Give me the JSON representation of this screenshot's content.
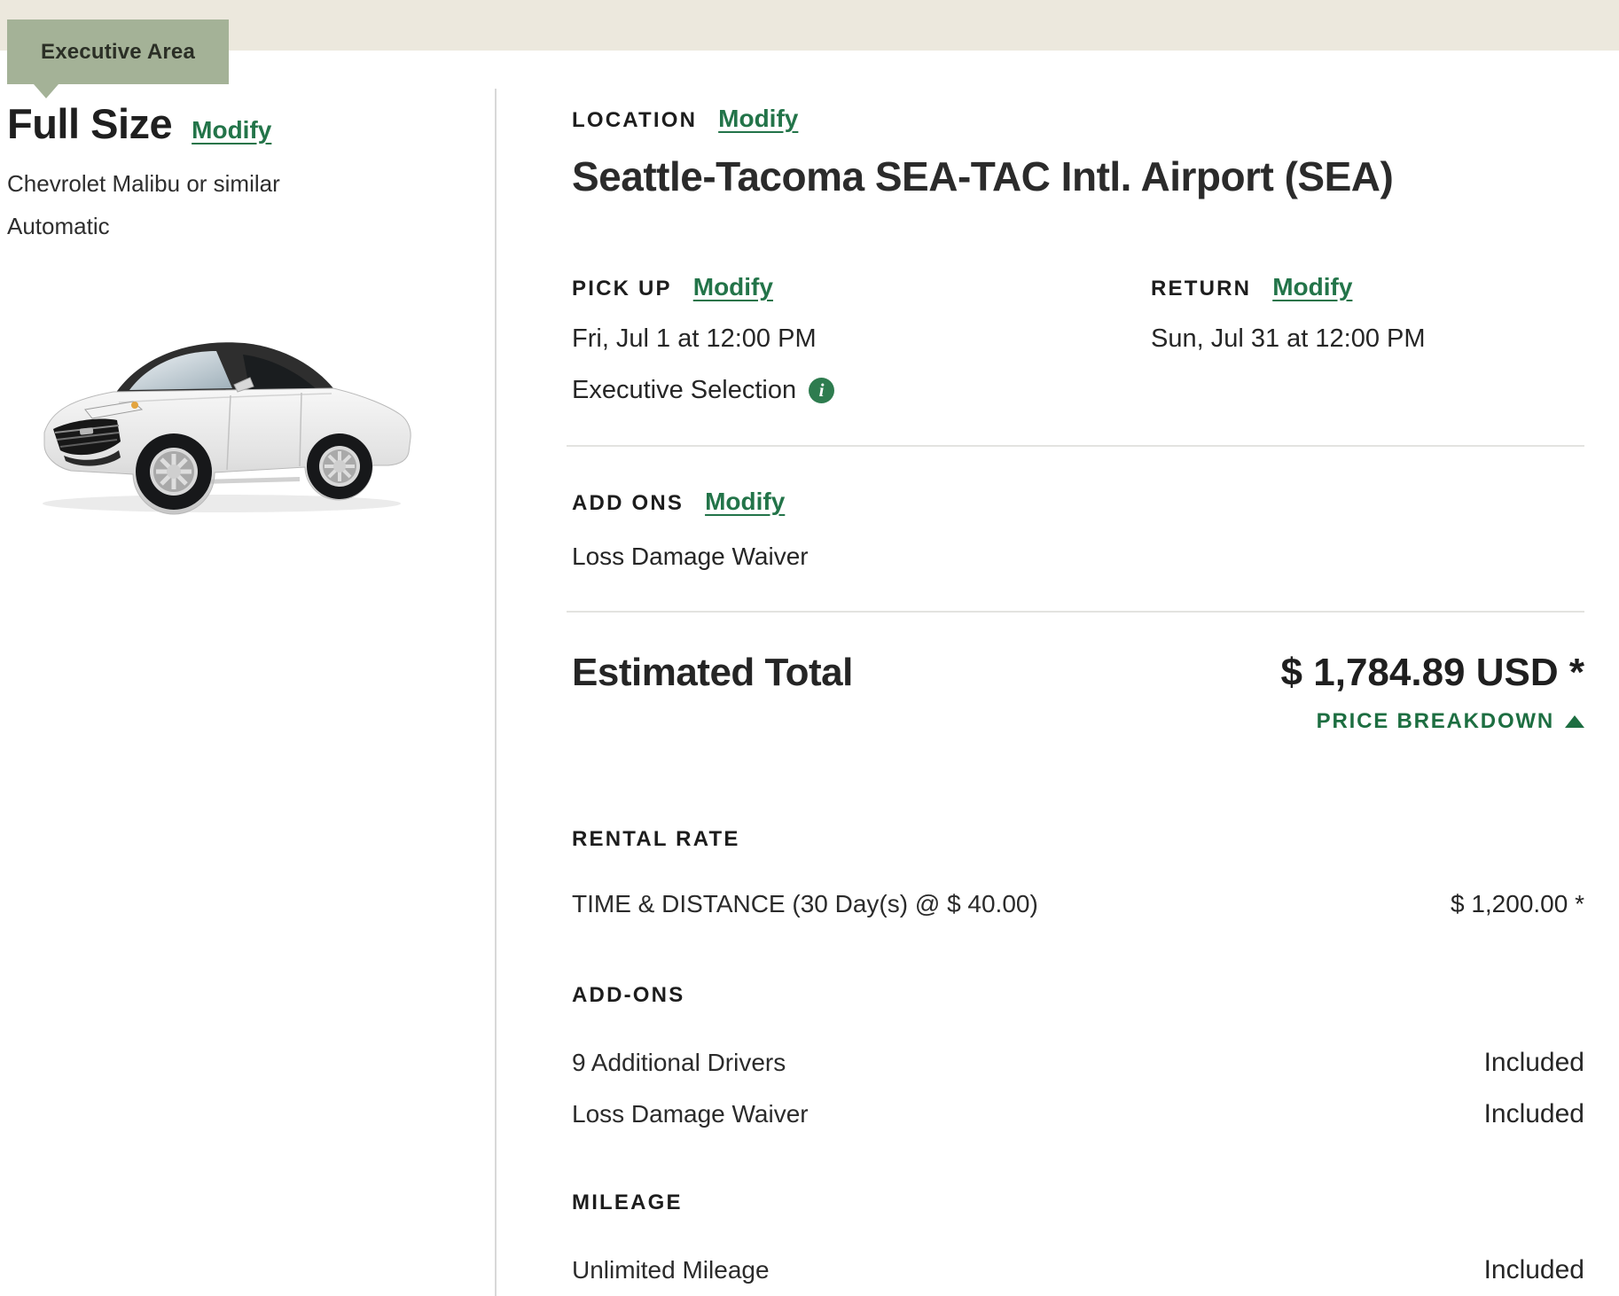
{
  "badge": {
    "label": "Executive Area"
  },
  "vehicle": {
    "class_label": "Full Size",
    "modify_label": "Modify",
    "model": "Chevrolet Malibu or similar",
    "transmission": "Automatic"
  },
  "location": {
    "label": "LOCATION",
    "modify_label": "Modify",
    "value": "Seattle-Tacoma SEA-TAC Intl. Airport (SEA)"
  },
  "pickup": {
    "label": "PICK UP",
    "modify_label": "Modify",
    "datetime": "Fri, Jul 1 at 12:00 PM",
    "note": "Executive Selection"
  },
  "return": {
    "label": "RETURN",
    "modify_label": "Modify",
    "datetime": "Sun, Jul 31 at 12:00 PM"
  },
  "addons_summary": {
    "label": "ADD ONS",
    "modify_label": "Modify",
    "items": [
      "Loss Damage Waiver"
    ]
  },
  "total": {
    "label": "Estimated Total",
    "amount": "$ 1,784.89 USD *",
    "breakdown_label": "PRICE BREAKDOWN"
  },
  "price_breakdown": {
    "rental_rate": {
      "label": "RENTAL RATE",
      "rows": [
        {
          "name": "TIME & DISTANCE (30 Day(s) @ $ 40.00)",
          "value": "$ 1,200.00 *"
        }
      ]
    },
    "addons": {
      "label": "ADD-ONS",
      "rows": [
        {
          "name": "9 Additional Drivers",
          "value": "Included"
        },
        {
          "name": "Loss Damage Waiver",
          "value": "Included"
        }
      ]
    },
    "mileage": {
      "label": "MILEAGE",
      "rows": [
        {
          "name": "Unlimited Mileage",
          "value": "Included"
        }
      ]
    }
  },
  "icons": {
    "info_icon_glyph": "i",
    "caret_up_icon": "css-triangle-up"
  },
  "colors": {
    "accent_green": "#237449",
    "breakdown_green": "#1d6e41",
    "badge_green": "#a4b297",
    "top_strip_beige": "#ece8dd",
    "info_icon_green": "#2e7c4f"
  }
}
